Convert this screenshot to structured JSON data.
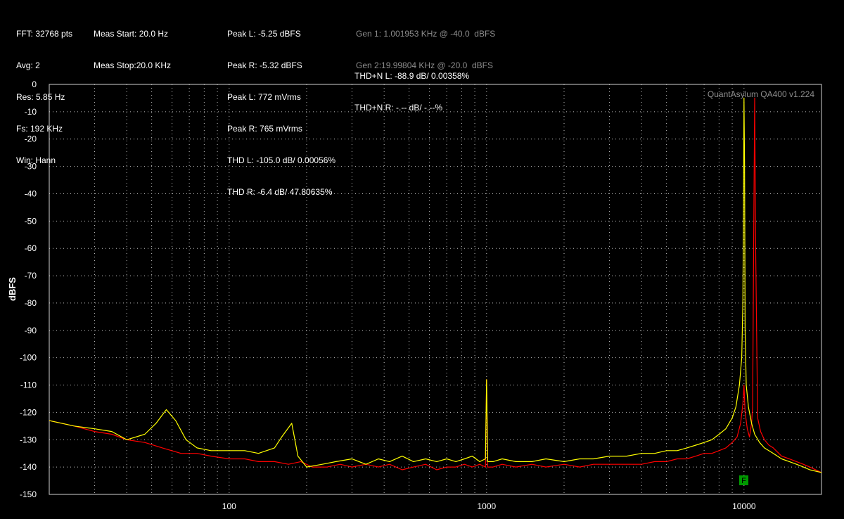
{
  "header": {
    "col1": [
      "FFT: 32768 pts",
      "Avg: 2",
      "Res: 5.85 Hz",
      "Fs: 192 KHz",
      "Win: Hann"
    ],
    "col2": [
      "Meas Start: 20.0 Hz",
      "Meas Stop:20.0 KHz"
    ],
    "col3": [
      "Peak L: -5.25 dBFS",
      "Peak R: -5.32 dBFS",
      "Peak L: 772 mVrms",
      "Peak R: 765 mVrms",
      "THD L: -105.0 dB/ 0.00056%",
      "THD R: -6.4 dB/ 47.80635%"
    ],
    "col4": [
      "THD+N L: -88.9 dB/ 0.00358%",
      "THD+N R: -.-- dB/ -.--%"
    ],
    "gen": [
      "Gen 1: 1.001953 KHz @ -40.0  dBFS",
      "Gen 2:19.99804 KHz @ -20.0  dBFS"
    ]
  },
  "watermark": "QuantAsylum QA400 v1.224",
  "marker": "F",
  "colors": {
    "background": "#000000",
    "left_channel": "#ffff00",
    "right_channel": "#ff0000",
    "grid": "#bfbfbf",
    "axis": "#cfcfcf",
    "marker_bg": "#009900"
  },
  "chart_data": {
    "type": "line",
    "xscale": "log",
    "xlim": [
      20,
      20000
    ],
    "ylim": [
      -150,
      0
    ],
    "ylabel": "dBFS",
    "xlabel": "",
    "xticks": [
      100,
      1000,
      10000
    ],
    "xtick_labels": [
      "100",
      "1000",
      "10000"
    ],
    "yticks": [
      0,
      -10,
      -20,
      -30,
      -40,
      -50,
      -60,
      -70,
      -80,
      -90,
      -100,
      -110,
      -120,
      -130,
      -140,
      -150
    ],
    "ytick_labels": [
      "0",
      "-10",
      "-20",
      "-30",
      "-40",
      "-50",
      "-60",
      "-70",
      "-80",
      "-90",
      "-100",
      "-110",
      "-120",
      "-130",
      "-140",
      "-150"
    ],
    "grid": true,
    "series": [
      {
        "color": "#ff0000",
        "x": [
          20,
          25,
          30,
          35,
          40,
          47,
          55,
          65,
          75,
          85,
          100,
          115,
          130,
          150,
          170,
          190,
          210,
          240,
          270,
          300,
          340,
          380,
          420,
          470,
          520,
          580,
          640,
          700,
          760,
          820,
          880,
          940,
          990,
          1000,
          1010,
          1060,
          1150,
          1300,
          1500,
          1700,
          2000,
          2300,
          2600,
          3000,
          3500,
          4000,
          4500,
          5000,
          5500,
          6000,
          6500,
          7000,
          7500,
          8000,
          8500,
          9000,
          9400,
          9700,
          9900,
          10000,
          10100,
          10300,
          10500,
          10700,
          10800,
          10900,
          11000,
          11100,
          11300,
          11600,
          12000,
          12500,
          13000,
          14000,
          15000,
          16000,
          17000,
          18000,
          20000
        ],
        "y": [
          -123,
          -125,
          -127,
          -128,
          -130,
          -131,
          -133,
          -135,
          -135,
          -136,
          -137,
          -137,
          -138,
          -138,
          -139,
          -138,
          -140,
          -140,
          -139,
          -140,
          -139,
          -140,
          -139,
          -141,
          -140,
          -139,
          -141,
          -140,
          -140,
          -139,
          -140,
          -139,
          -140,
          -108,
          -140,
          -140,
          -139,
          -140,
          -139,
          -140,
          -139,
          -140,
          -139,
          -139,
          -139,
          -139,
          -138,
          -138,
          -137,
          -137,
          -136,
          -135,
          -135,
          -134,
          -133,
          -131,
          -129,
          -124,
          -117,
          -110,
          -120,
          -126,
          -129,
          -124,
          -118,
          -60,
          -5,
          -60,
          -122,
          -127,
          -130,
          -132,
          -133,
          -136,
          -137,
          -138,
          -139,
          -140,
          -142
        ]
      },
      {
        "color": "#ffff00",
        "x": [
          20,
          25,
          30,
          35,
          40,
          47,
          52,
          57,
          62,
          68,
          75,
          85,
          100,
          115,
          130,
          150,
          160,
          175,
          185,
          200,
          230,
          260,
          300,
          340,
          380,
          420,
          470,
          520,
          580,
          640,
          700,
          760,
          820,
          880,
          940,
          990,
          1000,
          1010,
          1060,
          1150,
          1300,
          1500,
          1700,
          2000,
          2300,
          2600,
          3000,
          3500,
          4000,
          4500,
          5000,
          5500,
          6000,
          6500,
          7000,
          7500,
          8000,
          8500,
          9000,
          9300,
          9600,
          9800,
          9900,
          9950,
          10000,
          10050,
          10100,
          10200,
          10400,
          10700,
          11000,
          11500,
          12000,
          13000,
          14000,
          15000,
          16000,
          17000,
          18000,
          20000
        ],
        "y": [
          -123,
          -125,
          -126,
          -127,
          -130,
          -128,
          -124,
          -119,
          -123,
          -130,
          -133,
          -134,
          -134,
          -134,
          -135,
          -133,
          -129,
          -124,
          -136,
          -140,
          -139,
          -138,
          -137,
          -139,
          -137,
          -138,
          -136,
          -138,
          -137,
          -138,
          -137,
          -138,
          -137,
          -136,
          -138,
          -137,
          -108,
          -138,
          -138,
          -137,
          -138,
          -138,
          -137,
          -138,
          -137,
          -137,
          -136,
          -136,
          -135,
          -135,
          -134,
          -134,
          -133,
          -132,
          -131,
          -130,
          -128,
          -126,
          -122,
          -118,
          -110,
          -100,
          -80,
          -50,
          -5,
          -28,
          -90,
          -110,
          -118,
          -124,
          -128,
          -131,
          -133,
          -135,
          -137,
          -138,
          -139,
          -140,
          -141,
          -142
        ]
      }
    ]
  }
}
